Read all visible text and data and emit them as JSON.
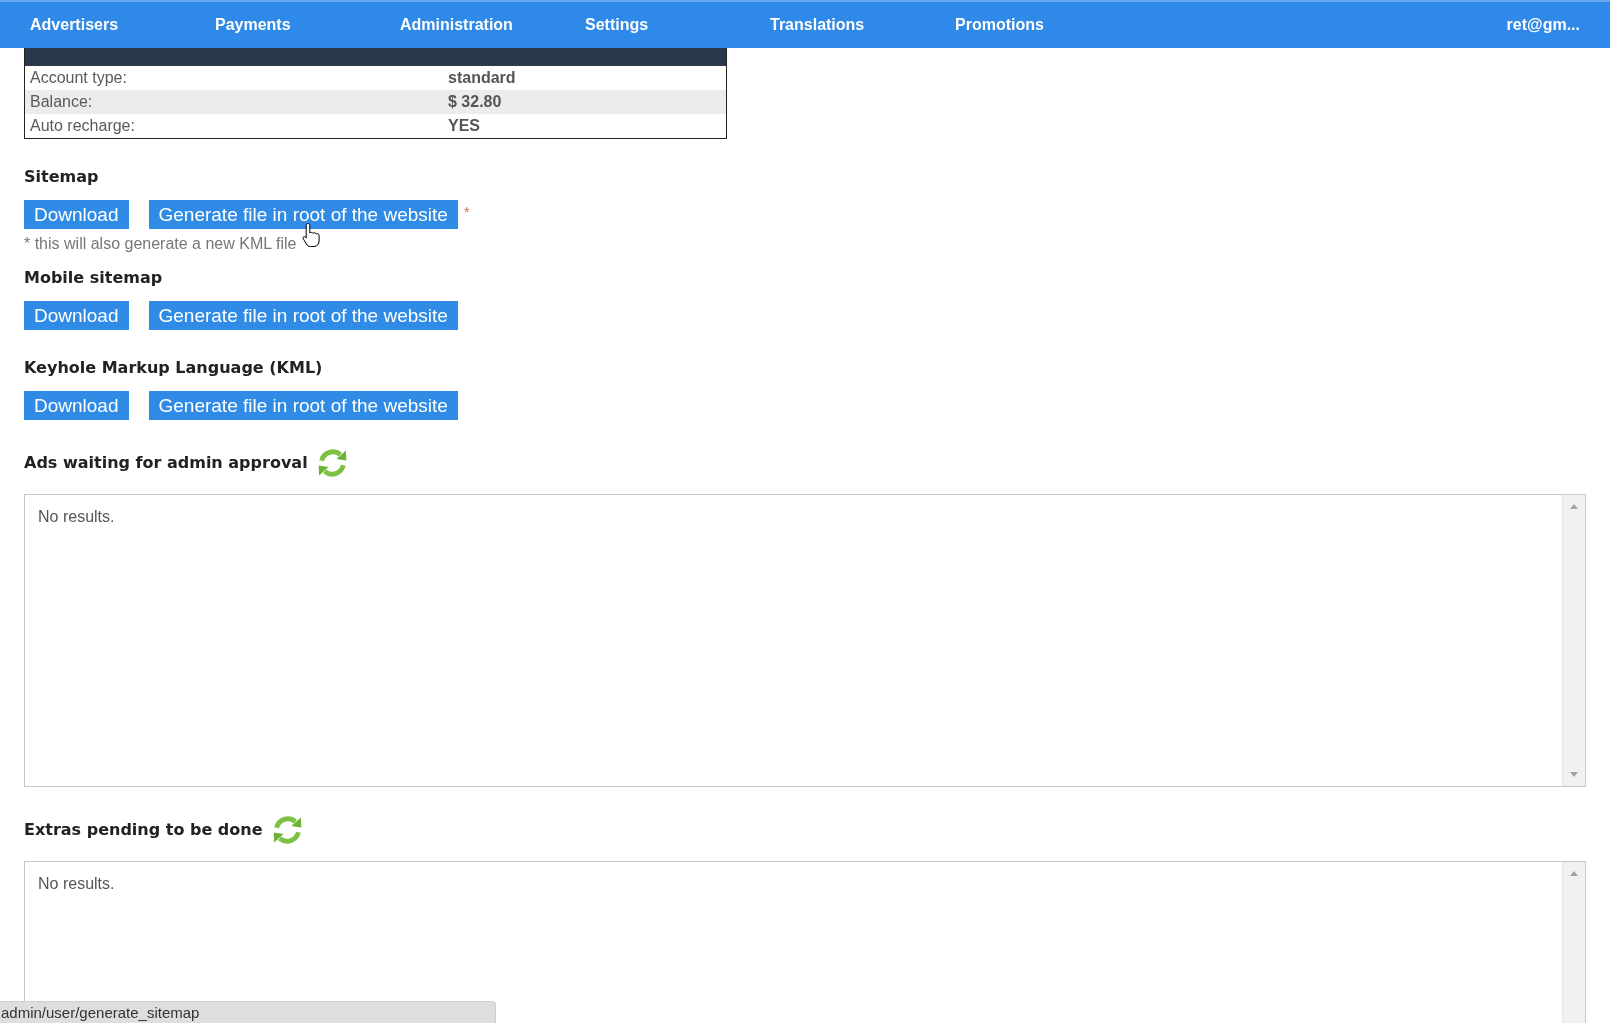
{
  "nav": {
    "items": [
      "Advertisers",
      "Payments",
      "Administration",
      "Settings",
      "Translations",
      "Promotions"
    ],
    "user": "ret@gm..."
  },
  "account": {
    "rows": [
      {
        "label": "Account type:",
        "value": "standard"
      },
      {
        "label": "Balance:",
        "value": "$ 32.80"
      },
      {
        "label": "Auto recharge:",
        "value": "YES"
      }
    ]
  },
  "file_sections": [
    {
      "title": "Sitemap",
      "buttons": [
        "Download",
        "Generate file in root of the website"
      ],
      "required_mark": "*",
      "note": "* this will also generate a new KML file"
    },
    {
      "title": "Mobile sitemap",
      "buttons": [
        "Download",
        "Generate file in root of the website"
      ]
    },
    {
      "title": "Keyhole Markup Language (KML)",
      "buttons": [
        "Download",
        "Generate file in root of the website"
      ]
    }
  ],
  "panels": [
    {
      "title": "Ads waiting for admin approval",
      "message": "No results."
    },
    {
      "title": "Extras pending to be done",
      "message": "No results."
    }
  ],
  "status_bar": {
    "url": "admin/user/generate_sitemap"
  }
}
